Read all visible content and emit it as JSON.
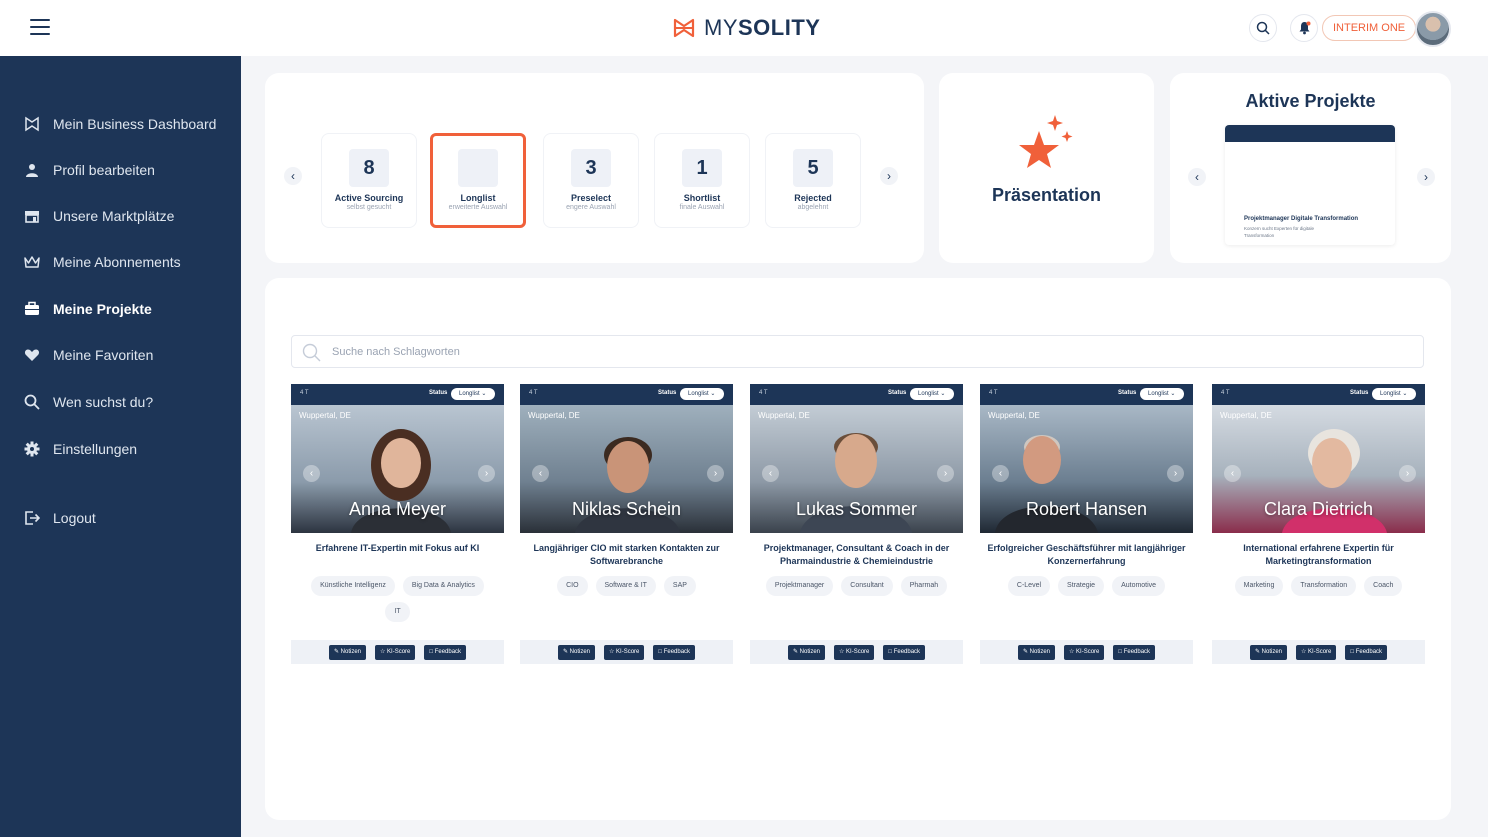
{
  "header": {
    "logo_prefix": "MY",
    "logo_suffix": "SOLITY",
    "interim_button": "INTERIM ONE"
  },
  "sidebar": {
    "items": [
      {
        "label": "Mein Business Dashboard",
        "icon": "dashboard-icon"
      },
      {
        "label": "Profil bearbeiten",
        "icon": "user-icon"
      },
      {
        "label": "Unsere Marktplätze",
        "icon": "store-icon"
      },
      {
        "label": "Meine Abonnements",
        "icon": "crown-icon"
      },
      {
        "label": "Meine Projekte",
        "icon": "briefcase-icon",
        "active": true
      },
      {
        "label": "Meine Favoriten",
        "icon": "heart-icon"
      },
      {
        "label": "Wen suchst du?",
        "icon": "search-icon"
      },
      {
        "label": "Einstellungen",
        "icon": "gear-icon"
      },
      {
        "label": "Logout",
        "icon": "logout-icon"
      }
    ]
  },
  "pipeline": {
    "stages": [
      {
        "count": "8",
        "label": "Active Sourcing",
        "sub": "selbst gesucht"
      },
      {
        "count": "",
        "label": "Longlist",
        "sub": "erweiterte Auswahl",
        "active": true
      },
      {
        "count": "3",
        "label": "Preselect",
        "sub": "engere Auswahl"
      },
      {
        "count": "1",
        "label": "Shortlist",
        "sub": "finale Auswahl"
      },
      {
        "count": "5",
        "label": "Rejected",
        "sub": "abgelehnt"
      }
    ]
  },
  "presentation": {
    "title": "Präsentation"
  },
  "projects": {
    "title": "Aktive Projekte",
    "card_title": "Projektmanager Digitale Transformation",
    "card_desc": "Konzern sucht Experten für digitale Transformation"
  },
  "search": {
    "placeholder": "Suche nach Schlagworten"
  },
  "candidate_labels": {
    "age": "4 T",
    "status": "Status",
    "status_value": "Longlist",
    "location": "Wuppertal, DE",
    "notes": "Notizen",
    "ki_score": "KI-Score",
    "feedback": "Feedback"
  },
  "candidates": [
    {
      "name": "Anna Meyer",
      "headline": "Erfahrene IT-Expertin mit Fokus auf KI",
      "tags": [
        "Künstliche Intelligenz",
        "Big Data & Analytics",
        "IT"
      ]
    },
    {
      "name": "Niklas Schein",
      "headline": "Langjähriger CIO mit starken Kontakten zur Softwarebranche",
      "tags": [
        "CIO",
        "Software & IT",
        "SAP"
      ]
    },
    {
      "name": "Lukas Sommer",
      "headline": "Projektmanager, Consultant & Coach in der Pharmaindustrie & Chemieindustrie",
      "tags": [
        "Projektmanager",
        "Consultant",
        "Pharmah"
      ]
    },
    {
      "name": "Robert Hansen",
      "headline": "Erfolgreicher Geschäftsführer mit langjähriger Konzernerfahrung",
      "tags": [
        "C-Level",
        "Strategie",
        "Automotive"
      ]
    },
    {
      "name": "Clara Dietrich",
      "headline": "International erfahrene Expertin für Marketingtransformation",
      "tags": [
        "Marketing",
        "Transformation",
        "Coach"
      ]
    }
  ],
  "colors": {
    "navy": "#1d3557",
    "accent": "#f0603a",
    "background": "#f4f5f8"
  }
}
